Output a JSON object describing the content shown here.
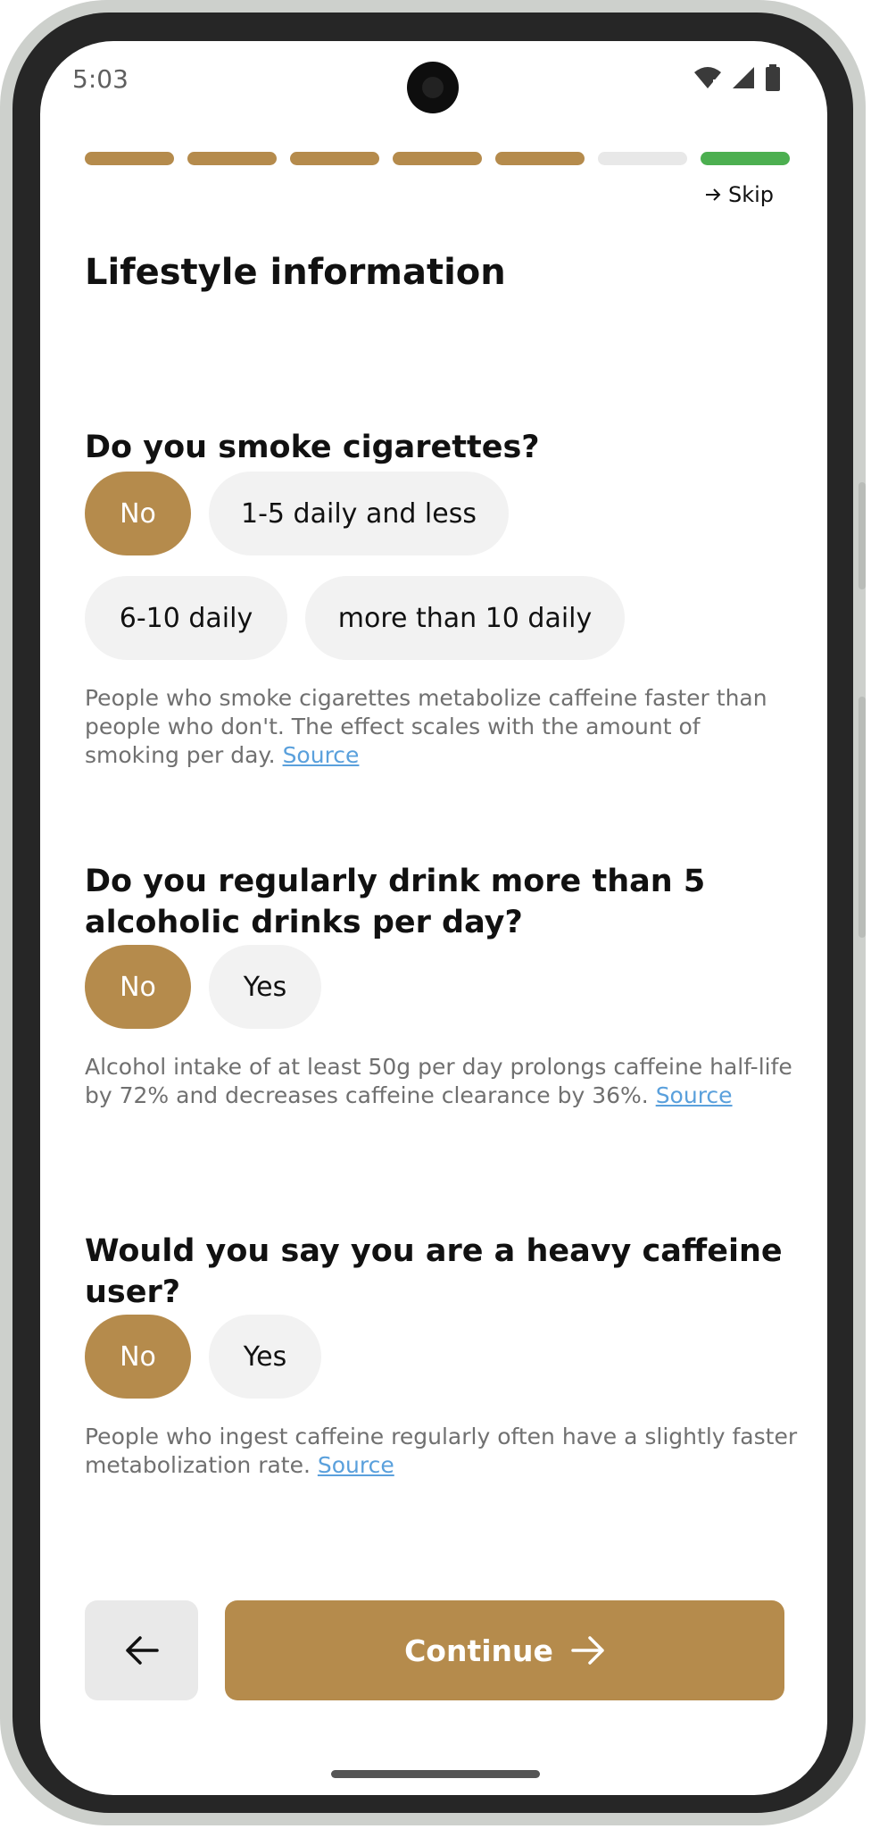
{
  "status_bar": {
    "time": "5:03",
    "icons": [
      "wifi-icon",
      "signal-icon",
      "battery-icon"
    ]
  },
  "progress": {
    "segments": [
      "done",
      "done",
      "done",
      "done",
      "done",
      "empty",
      "active"
    ],
    "colors": {
      "done": "#b58b4c",
      "empty": "#e8e8e8",
      "active": "#4caf50"
    }
  },
  "header": {
    "skip_label": "Skip",
    "title": "Lifestyle information"
  },
  "questions": {
    "smoking": {
      "title": "Do you smoke cigarettes?",
      "options": [
        "No",
        "1-5 daily and less",
        "6-10 daily",
        "more than 10 daily"
      ],
      "selected": "No",
      "description": "People who smoke cigarettes metabolize caffeine faster than people who don't. The effect scales with the amount of smoking per day.",
      "source_label": "Source"
    },
    "alcohol": {
      "title": "Do you regularly drink more than 5 alcoholic drinks per day?",
      "options": [
        "No",
        "Yes"
      ],
      "selected": "No",
      "description": "Alcohol intake of at least 50g per day prolongs caffeine half-life by 72% and decreases caffeine clearance by 36%.",
      "source_label": "Source"
    },
    "caffeine": {
      "title": "Would you say you are a heavy caffeine user?",
      "options": [
        "No",
        "Yes"
      ],
      "selected": "No",
      "description": "People who ingest caffeine regularly often have a slightly faster metabolization rate.",
      "source_label": "Source"
    }
  },
  "footer": {
    "back_icon": "arrow-left-icon",
    "continue_label": "Continue",
    "continue_icon": "arrow-right-icon"
  },
  "colors": {
    "accent": "#b58b4c",
    "chip_bg": "#f2f2f2",
    "link": "#5aa0dc",
    "progress_active": "#4caf50"
  }
}
